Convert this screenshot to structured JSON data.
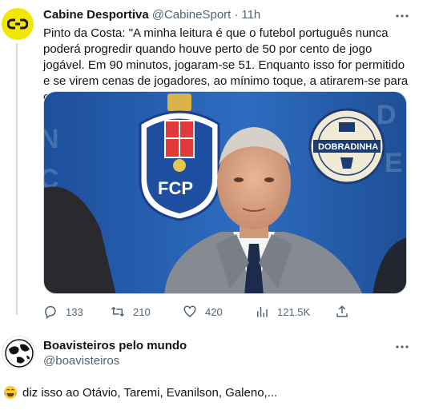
{
  "tweet": {
    "author_name": "Cabine Desportiva",
    "author_handle": "@CabineSport",
    "separator": "·",
    "time": "11h",
    "text": "Pinto da Costa: \"A minha leitura é que o futebol português nunca poderá progredir quando houve perto de 50 por cento de jogo jogável. Em 90 minutos, jogaram-se  51. Enquanto isso for permitido e se virem cenas de jogadores, ao mínimo toque, a atirarem-se para o chão.\"",
    "image": {
      "crest_letters": "FCP",
      "badge_text": "DOBRADINHA"
    },
    "actions": {
      "replies": "133",
      "retweets": "210",
      "likes": "420",
      "views": "121.5K"
    }
  },
  "reply": {
    "author_name": "Boavisteiros pelo mundo",
    "author_handle": "@boavisteiros",
    "emoji": "laughing-with-tears",
    "text": "diz isso ao Otávio, Taremi, Evanilson, Galeno,..."
  },
  "colors": {
    "text": "#0f1419",
    "secondary": "#536471",
    "cabine_brand": "#f3e600",
    "thread_line": "#cfd9de"
  }
}
